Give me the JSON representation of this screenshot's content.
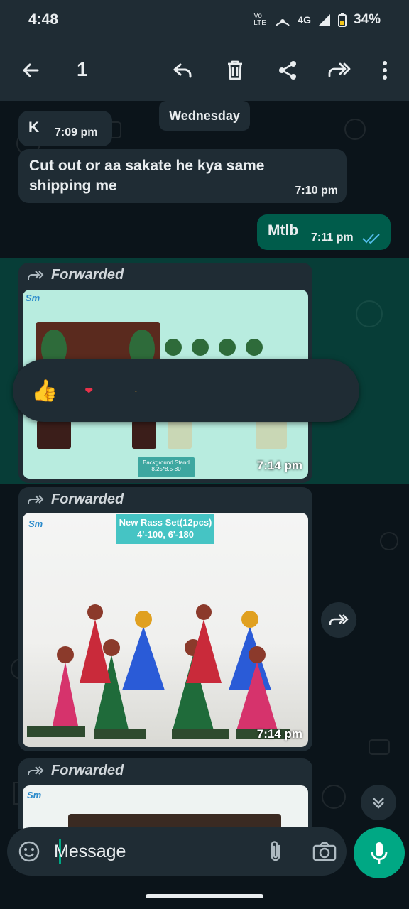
{
  "status": {
    "time": "4:48",
    "network": "4G",
    "volte": "Vo LTE",
    "battery": "34%"
  },
  "appbar": {
    "selected_count": "1"
  },
  "chat": {
    "day_chip": "Wednesday",
    "messages": [
      {
        "text": "K",
        "time": "7:09 pm"
      },
      {
        "text": "Cut out or aa sakate he kya same shipping me",
        "time": "7:10 pm"
      },
      {
        "text": "Mtlb",
        "time": "7:11 pm"
      }
    ],
    "media": [
      {
        "forward_label": "Forwarded",
        "time": "7:14 pm",
        "caption": "Background Stand",
        "caption_sub": "8.25*8.5-80"
      },
      {
        "forward_label": "Forwarded",
        "time": "7:14 pm",
        "caption": "New Rass Set(12pcs)",
        "caption_sub": "4'-100, 6'-180"
      },
      {
        "forward_label": "Forwarded"
      }
    ],
    "reactions": [
      "👍",
      "❤",
      "·"
    ]
  },
  "input": {
    "placeholder": "Message"
  },
  "colors": {
    "accent": "#00a884",
    "incoming": "#1f2c34",
    "outgoing": "#005c4b",
    "background": "#0b141a"
  }
}
